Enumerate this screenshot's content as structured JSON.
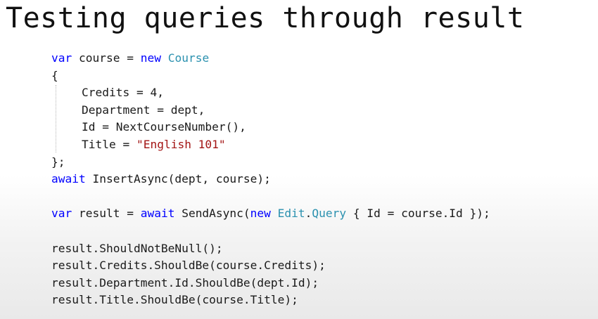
{
  "slide": {
    "title": "Testing queries through result"
  },
  "code": {
    "l1": {
      "kw": "var",
      "t1": " course = ",
      "kw2": "new",
      "t2": " ",
      "type": "Course"
    },
    "l2": "{",
    "l3": "Credits = 4,",
    "l4": "Department = dept,",
    "l5": "Id = NextCourseNumber(),",
    "l6": {
      "t1": "Title = ",
      "str": "\"English 101\""
    },
    "l7": "};",
    "l8": {
      "kw": "await",
      "t1": " InsertAsync(dept, course);"
    },
    "l9": {
      "kw": "var",
      "t1": " result = ",
      "kw2": "await",
      "t2": " SendAsync(",
      "kw3": "new",
      "t3": " ",
      "type1": "Edit",
      "t4": ".",
      "type2": "Query",
      "t5": " { Id = course.Id });"
    },
    "l10": "result.ShouldNotBeNull();",
    "l11": "result.Credits.ShouldBe(course.Credits);",
    "l12": "result.Department.Id.ShouldBe(dept.Id);",
    "l13": "result.Title.ShouldBe(course.Title);"
  }
}
